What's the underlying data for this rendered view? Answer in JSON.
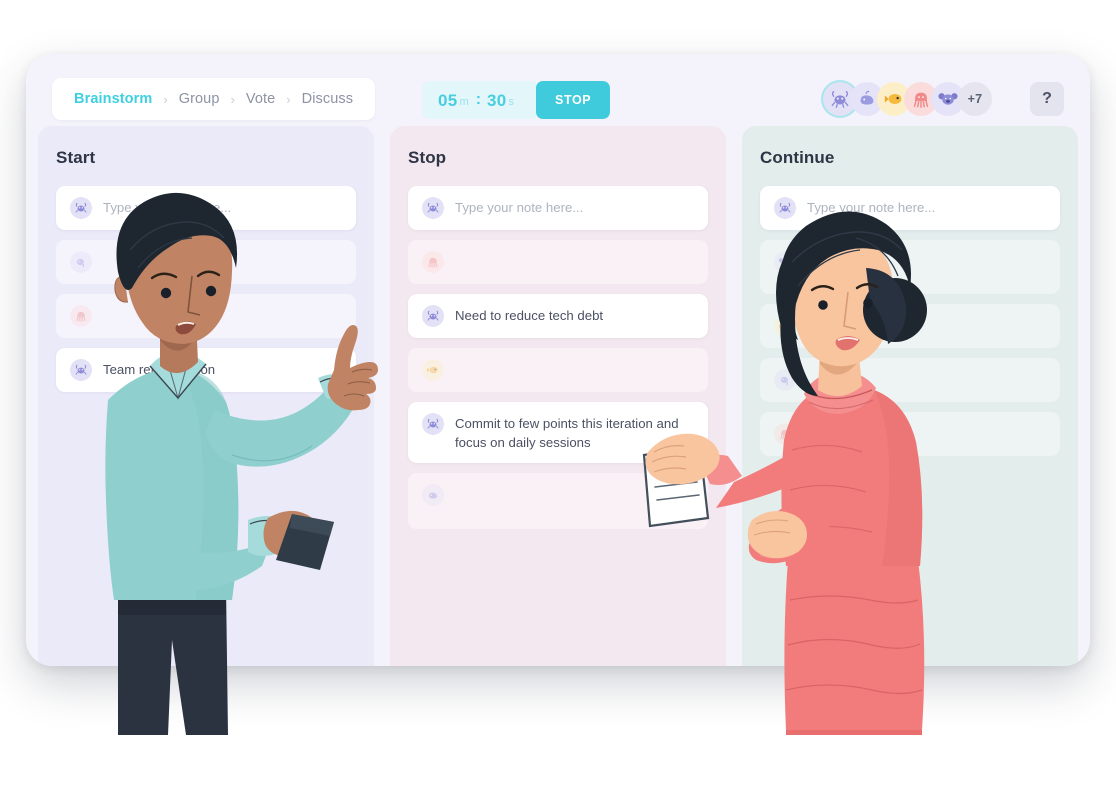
{
  "header": {
    "breadcrumb": {
      "separator": "›",
      "items": [
        {
          "label": "Brainstorm",
          "active": true
        },
        {
          "label": "Group",
          "active": false
        },
        {
          "label": "Vote",
          "active": false
        },
        {
          "label": "Discuss",
          "active": false
        }
      ]
    },
    "timer": {
      "minutes": "05",
      "minutes_unit": "m",
      "colon": ":",
      "seconds": "30",
      "seconds_unit": "s",
      "stop_label": "STOP",
      "stop_color": "#3FCBDC",
      "display_bg": "#E3F7FB",
      "display_color": "#49CEE0"
    },
    "participants": {
      "avatars": [
        {
          "icon": "crab-avatar",
          "glyph": "🦞",
          "bg": "#E3E1F6",
          "active": true
        },
        {
          "icon": "whale-avatar",
          "glyph": "🐳",
          "bg": "#E5E3F7",
          "active": false
        },
        {
          "icon": "fish-avatar",
          "glyph": "🐠",
          "bg": "#FCEFC8",
          "active": false
        },
        {
          "icon": "octopus-avatar",
          "glyph": "🐙",
          "bg": "#FBDCDC",
          "active": false
        },
        {
          "icon": "koala-avatar",
          "glyph": "🐨",
          "bg": "#E5E3F7",
          "active": false
        }
      ],
      "overflow_label": "+7"
    },
    "help_label": "?"
  },
  "board": {
    "columns": [
      {
        "title": "Start",
        "bg": "#EBEAF9",
        "notes": [
          {
            "type": "input",
            "placeholder": "Type your note here...",
            "avatar_glyph": "🦞",
            "avatar_bg": "#E3E1F6"
          },
          {
            "type": "ghost",
            "text": "",
            "avatar_glyph": "🐘",
            "avatar_bg": "#E3E1F6"
          },
          {
            "type": "ghost",
            "text": "",
            "avatar_glyph": "🐙",
            "avatar_bg": "#FBDCDC"
          },
          {
            "type": "filled",
            "text": "Team retrospection",
            "avatar_glyph": "🦞",
            "avatar_bg": "#E3E1F6"
          }
        ]
      },
      {
        "title": "Stop",
        "bg": "#F4E8F0",
        "notes": [
          {
            "type": "input",
            "placeholder": "Type your note here...",
            "avatar_glyph": "🦞",
            "avatar_bg": "#E3E1F6"
          },
          {
            "type": "ghost",
            "text": "",
            "avatar_glyph": "🐙",
            "avatar_bg": "#FBDCDC"
          },
          {
            "type": "filled",
            "text": "Need to reduce tech debt",
            "avatar_glyph": "🦞",
            "avatar_bg": "#E3E1F6"
          },
          {
            "type": "ghost",
            "text": "",
            "avatar_glyph": "🐠",
            "avatar_bg": "#FCEFC8"
          },
          {
            "type": "filled",
            "text": "Commit to few points this iteration and focus on daily sessions",
            "avatar_glyph": "🦞",
            "avatar_bg": "#E3E1F6"
          },
          {
            "type": "ghost",
            "text": "",
            "avatar_glyph": "🐳",
            "avatar_bg": "#E5E3F7"
          }
        ]
      },
      {
        "title": "Continue",
        "bg": "#E3EDEC",
        "notes": [
          {
            "type": "input",
            "placeholder": "Type your note here...",
            "avatar_glyph": "🦞",
            "avatar_bg": "#E3E1F6"
          },
          {
            "type": "ghost",
            "text": "",
            "avatar_glyph": "🐨",
            "avatar_bg": "#E5E3F7"
          },
          {
            "type": "ghost",
            "text": "",
            "avatar_glyph": "🐠",
            "avatar_bg": "#FCEFC8"
          },
          {
            "type": "ghost",
            "text": "",
            "avatar_glyph": "🐘",
            "avatar_bg": "#E3E1F6"
          },
          {
            "type": "ghost",
            "text": "",
            "avatar_glyph": "🐙",
            "avatar_bg": "#FBDCDC"
          }
        ]
      }
    ]
  },
  "illustration": {
    "left_person": "man-pointing-teal-shirt",
    "right_person": "woman-coral-dress-holding-document",
    "document": "paper-with-chart"
  }
}
